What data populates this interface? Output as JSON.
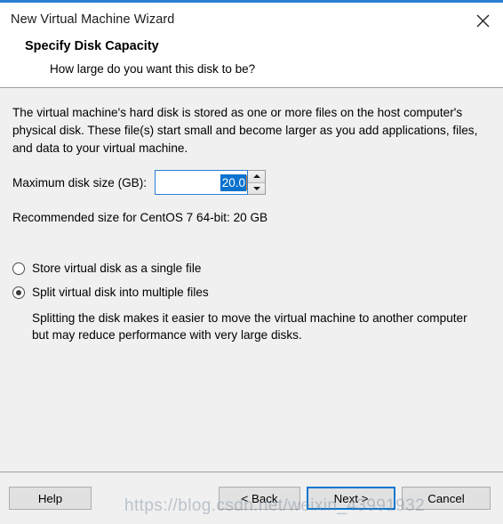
{
  "window": {
    "title": "New Virtual Machine Wizard",
    "close_icon": "close-icon",
    "accent_color": "#2a7fd4"
  },
  "header": {
    "heading": "Specify Disk Capacity",
    "subheading": "How large do you want this disk to be?"
  },
  "main": {
    "intro_paragraph": "The virtual machine's hard disk is stored as one or more files on the host computer's physical disk. These file(s) start small and become larger as you add applications, files, and data to your virtual machine.",
    "disk_size": {
      "label": "Maximum disk size (GB):",
      "value": "20.0",
      "placeholder": "",
      "selected": true,
      "selection_color": "#0b72cf",
      "focus_border_color": "#2a7fd4",
      "spinner_up_icon": "triangle-up-icon",
      "spinner_down_icon": "triangle-down-icon"
    },
    "recommended_text": "Recommended size for CentOS 7 64-bit: 20 GB",
    "storage_options": [
      {
        "label": "Store virtual disk as a single file",
        "selected": false
      },
      {
        "label": "Split virtual disk into multiple files",
        "selected": true
      }
    ],
    "storage_hint": "Splitting the disk makes it easier to move the virtual machine to another computer but may reduce performance with very large disks."
  },
  "footer": {
    "help_label": "Help",
    "back_label": "< Back",
    "next_label": "Next >",
    "cancel_label": "Cancel",
    "default_button": "Next >",
    "default_button_border_color": "#0a76d0"
  },
  "watermark": {
    "text": "https://blog.csdn.net/weixin_43991932"
  }
}
